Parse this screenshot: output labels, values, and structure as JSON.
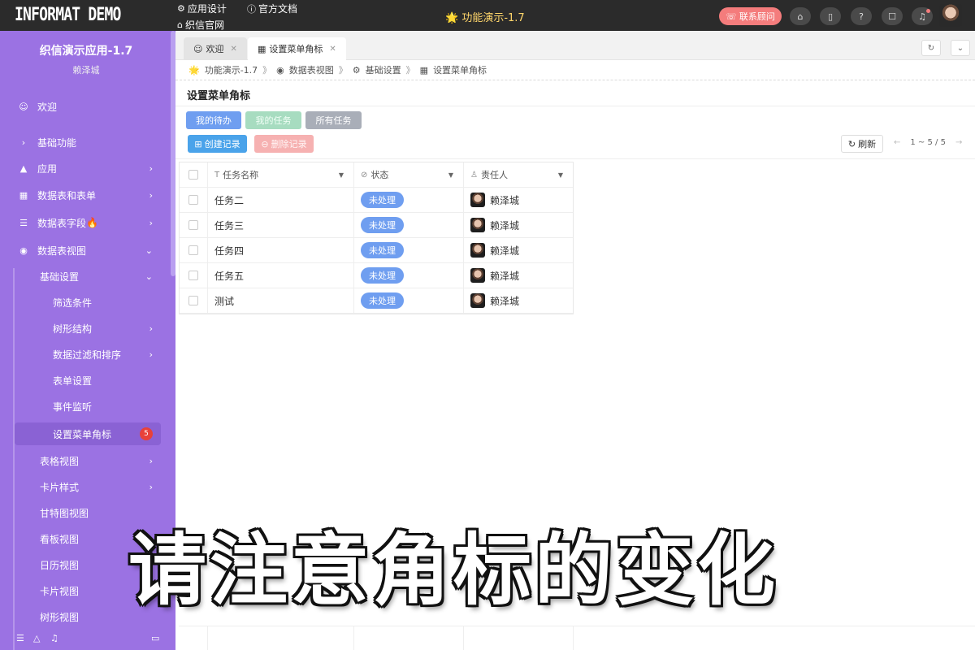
{
  "topbar": {
    "logo": "INFORMAT DEMO",
    "app_design": "应用设计",
    "docs": "官方文档",
    "website": "织信官网",
    "center_title": "功能演示-1.7",
    "consult": "联系顾问",
    "icons": [
      "home-icon",
      "book-icon",
      "help-icon",
      "robot-icon",
      "bell-icon"
    ]
  },
  "sidebar": {
    "app_title": "织信演示应用-1.7",
    "app_subtitle": "赖泽城",
    "welcome": "欢迎",
    "basic": "基础功能",
    "app": "应用",
    "tables_forms": "数据表和表单",
    "table_fields": "数据表字段",
    "table_views": "数据表视图",
    "basic_settings": "基础设置",
    "filter": "筛选条件",
    "tree": "树形结构",
    "filter_sort": "数据过滤和排序",
    "form_settings": "表单设置",
    "event_listen": "事件监听",
    "menu_badge": "设置菜单角标",
    "menu_badge_count": "5",
    "table_view": "表格视图",
    "card_style": "卡片样式",
    "gantt_view": "甘特图视图",
    "kanban_view": "看板视图",
    "calendar_view": "日历视图",
    "card_view": "卡片视图",
    "tree_view": "树形视图"
  },
  "tabs": {
    "welcome": "欢迎",
    "current": "设置菜单角标"
  },
  "breadcrumb": [
    "功能演示-1.7",
    "数据表视图",
    "基础设置",
    "设置菜单角标"
  ],
  "page": {
    "title": "设置菜单角标",
    "filters": [
      "我的待办",
      "我的任务",
      "所有任务"
    ],
    "create": "创建记录",
    "delete": "删除记录",
    "refresh": "刷新",
    "pager": "1 ~ 5 / 5"
  },
  "table": {
    "columns": [
      "任务名称",
      "状态",
      "责任人"
    ],
    "rows": [
      {
        "name": "任务二",
        "status": "未处理",
        "owner": "赖泽城"
      },
      {
        "name": "任务三",
        "status": "未处理",
        "owner": "赖泽城"
      },
      {
        "name": "任务四",
        "status": "未处理",
        "owner": "赖泽城"
      },
      {
        "name": "任务五",
        "status": "未处理",
        "owner": "赖泽城"
      },
      {
        "name": "测试",
        "status": "未处理",
        "owner": "赖泽城"
      }
    ]
  },
  "caption": "请注意角标的变化",
  "colors": {
    "sidebar": "#9b72e3",
    "topbar": "#2b2b2b",
    "status": "#6f9ef0",
    "consult": "#f47c7c",
    "badge": "#e8413a"
  }
}
